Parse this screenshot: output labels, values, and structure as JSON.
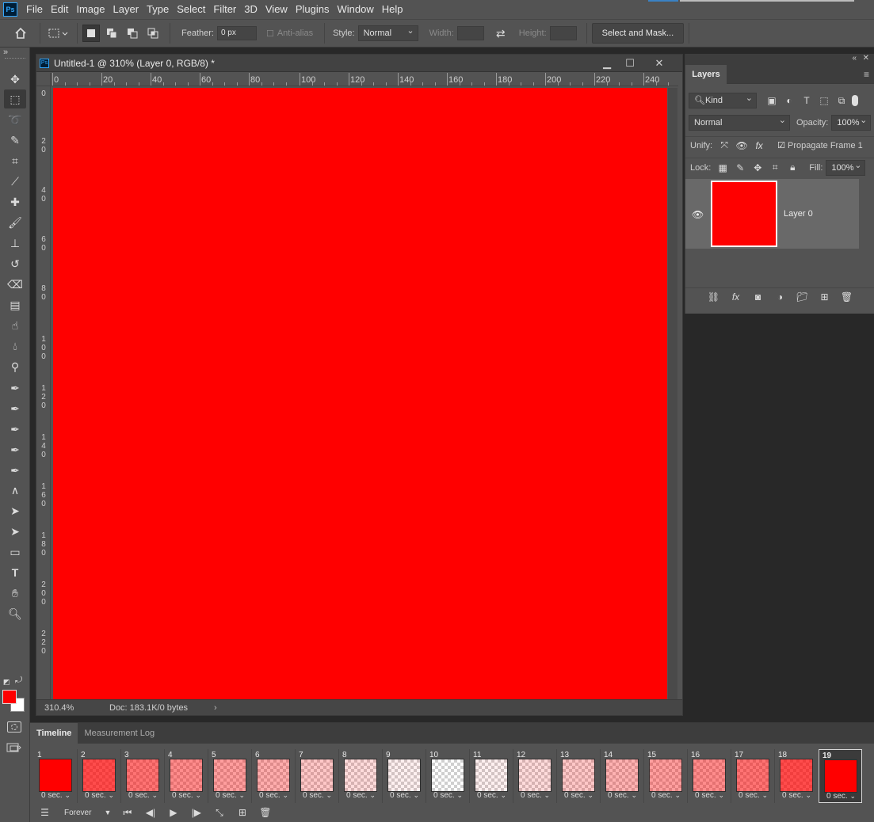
{
  "app": {
    "logo": "Ps"
  },
  "menu": [
    "File",
    "Edit",
    "Image",
    "Layer",
    "Type",
    "Select",
    "Filter",
    "3D",
    "View",
    "Plugins",
    "Window",
    "Help"
  ],
  "options": {
    "feather_label": "Feather:",
    "feather_value": "0 px",
    "antialias_label": "Anti-alias",
    "style_label": "Style:",
    "style_value": "Normal",
    "width_label": "Width:",
    "height_label": "Height:",
    "select_mask_label": "Select and Mask..."
  },
  "document": {
    "title": "Untitled-1 @ 310% (Layer 0, RGB/8) *",
    "canvas_color": "#ff0000",
    "ruler_top": [
      "0",
      "20",
      "40",
      "60",
      "80",
      "100",
      "120",
      "140",
      "160",
      "180",
      "200",
      "220",
      "240"
    ],
    "ruler_left": [
      "0",
      "20",
      "40",
      "60",
      "80",
      "100",
      "120",
      "140",
      "160",
      "180",
      "200",
      "220"
    ],
    "zoom": "310.4%",
    "doc_info": "Doc: 183.1K/0 bytes"
  },
  "layers_panel": {
    "tab_label": "Layers",
    "filter_kind": "Kind",
    "blend_mode": "Normal",
    "opacity_label": "Opacity:",
    "opacity_value": "100%",
    "unify_label": "Unify:",
    "propagate_label": "Propagate Frame 1",
    "lock_label": "Lock:",
    "fill_label": "Fill:",
    "fill_value": "100%",
    "layers": [
      {
        "name": "Layer 0",
        "color": "#ff0000",
        "visible": true
      }
    ]
  },
  "timeline": {
    "tabs": [
      "Timeline",
      "Measurement Log"
    ],
    "loop": "Forever",
    "frames": [
      {
        "num": "1",
        "delay": "0 sec.",
        "opacity": 1.0
      },
      {
        "num": "2",
        "delay": "0 sec.",
        "opacity": 0.7
      },
      {
        "num": "3",
        "delay": "0 sec.",
        "opacity": 0.55
      },
      {
        "num": "4",
        "delay": "0 sec.",
        "opacity": 0.45
      },
      {
        "num": "5",
        "delay": "0 sec.",
        "opacity": 0.38
      },
      {
        "num": "6",
        "delay": "0 sec.",
        "opacity": 0.32
      },
      {
        "num": "7",
        "delay": "0 sec.",
        "opacity": 0.22
      },
      {
        "num": "8",
        "delay": "0 sec.",
        "opacity": 0.14
      },
      {
        "num": "9",
        "delay": "0 sec.",
        "opacity": 0.06
      },
      {
        "num": "10",
        "delay": "0 sec.",
        "opacity": 0.0
      },
      {
        "num": "11",
        "delay": "0 sec.",
        "opacity": 0.06
      },
      {
        "num": "12",
        "delay": "0 sec.",
        "opacity": 0.14
      },
      {
        "num": "13",
        "delay": "0 sec.",
        "opacity": 0.22
      },
      {
        "num": "14",
        "delay": "0 sec.",
        "opacity": 0.3
      },
      {
        "num": "15",
        "delay": "0 sec.",
        "opacity": 0.38
      },
      {
        "num": "16",
        "delay": "0 sec.",
        "opacity": 0.45
      },
      {
        "num": "17",
        "delay": "0 sec.",
        "opacity": 0.55
      },
      {
        "num": "18",
        "delay": "0 sec.",
        "opacity": 0.7
      },
      {
        "num": "19",
        "delay": "0 sec.",
        "opacity": 1.0,
        "selected": true
      }
    ]
  },
  "tools": [
    "move-tool-icon",
    "marquee-tool-icon",
    "lasso-tool-icon",
    "quick-select-tool-icon",
    "crop-tool-icon",
    "eyedropper-tool-icon",
    "healing-brush-icon",
    "brush-tool-icon",
    "stamp-tool-icon",
    "history-brush-icon",
    "eraser-tool-icon",
    "gradient-tool-icon",
    "smudge-tool-icon",
    "blur-tool-icon",
    "dodge-tool-icon",
    "pen-tool-icon",
    "freeform-pen-icon",
    "curvature-pen-icon",
    "add-anchor-icon",
    "delete-anchor-icon",
    "convert-point-icon",
    "path-select-icon",
    "direct-select-icon",
    "rectangle-tool-icon",
    "type-tool-icon",
    "hand-tool-icon",
    "zoom-tool-icon"
  ],
  "colors": {
    "foreground": "#ff0000",
    "background": "#ffffff"
  }
}
